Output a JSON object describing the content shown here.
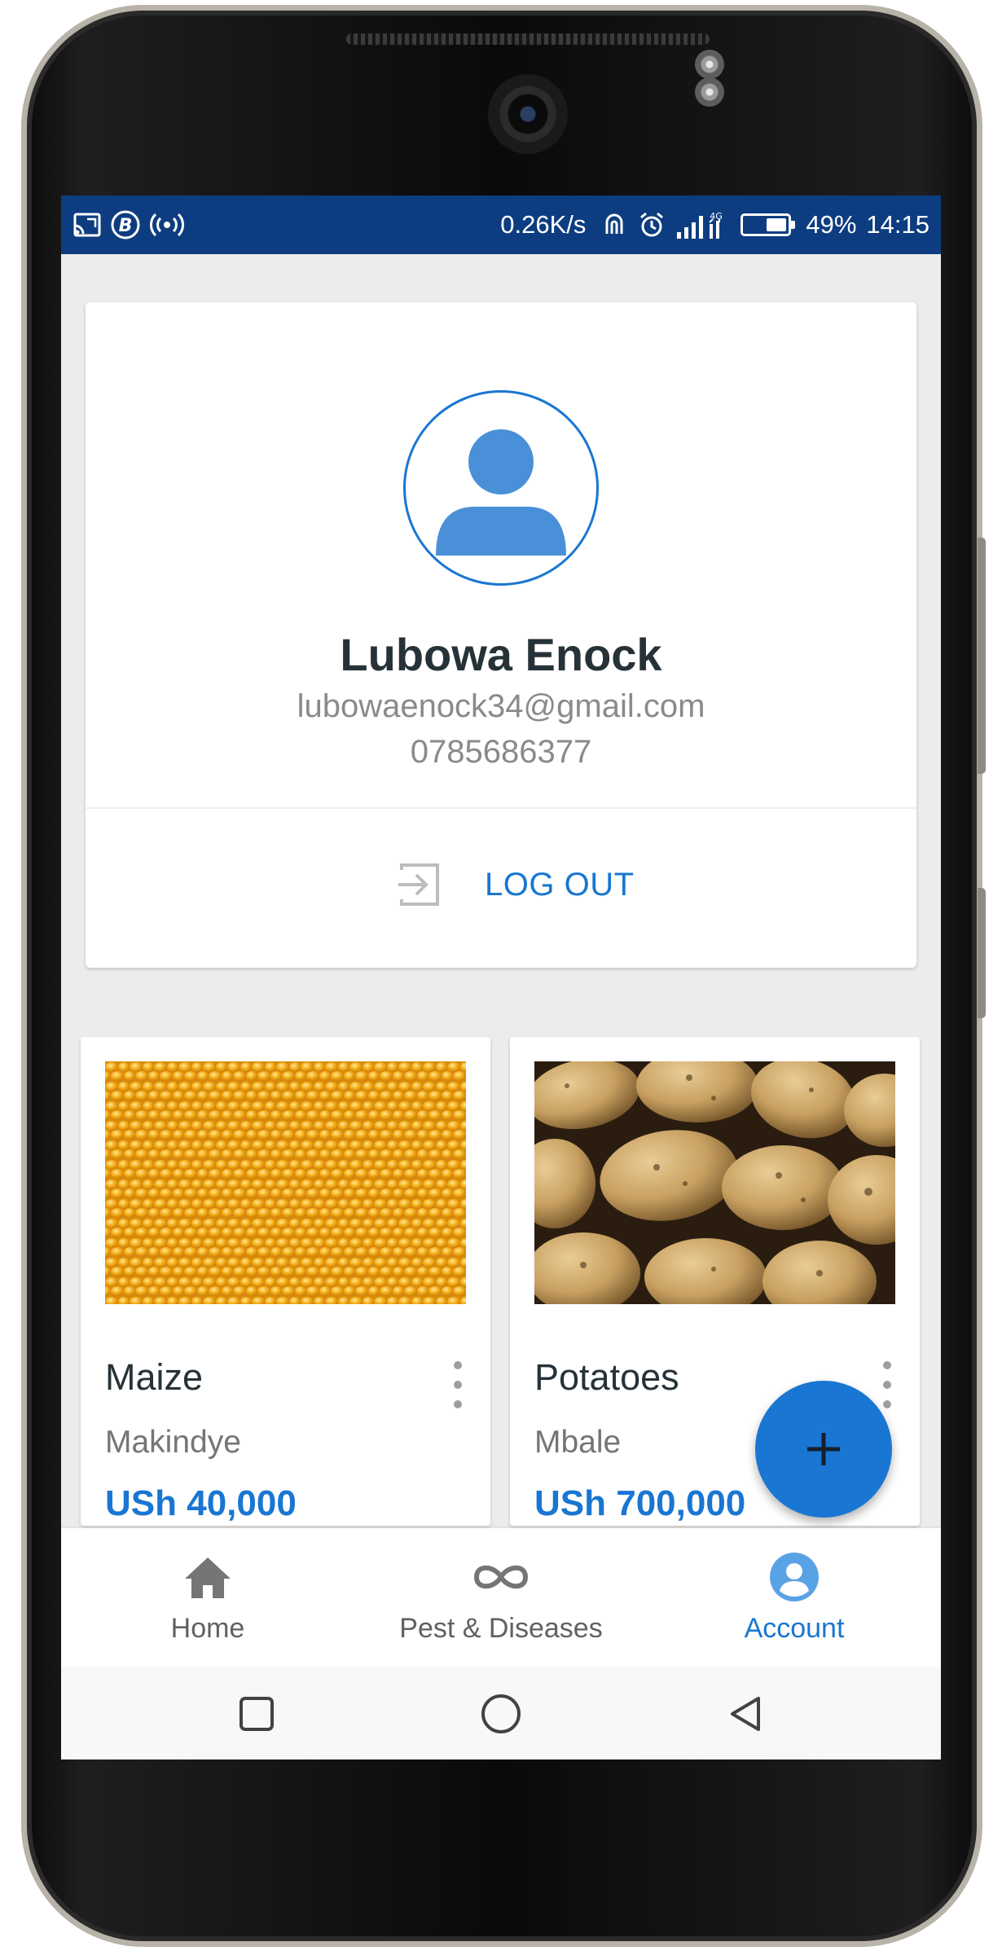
{
  "status_bar": {
    "network_speed": "0.26K/s",
    "signal_type": "4G",
    "battery_percent": "49%",
    "battery_level": 0.49,
    "time": "14:15",
    "icons": [
      "screencast-icon",
      "b-app-icon",
      "hotspot-icon",
      "nfc-icon",
      "alarm-icon",
      "signal-icon",
      "battery-icon"
    ]
  },
  "profile": {
    "name": "Lubowa Enock",
    "email": "lubowaenock34@gmail.com",
    "phone": "0785686377",
    "logout_label": "LOG OUT"
  },
  "products": [
    {
      "name": "Maize",
      "location": "Makindye",
      "price": "USh 40,000"
    },
    {
      "name": "Potatoes",
      "location": "Mbale",
      "price": "USh 700,000"
    }
  ],
  "fab": {
    "icon": "plus-icon"
  },
  "bottom_nav": {
    "items": [
      {
        "label": "Home",
        "icon": "home-icon",
        "active": false
      },
      {
        "label": "Pest & Diseases",
        "icon": "infinity-icon",
        "active": false
      },
      {
        "label": "Account",
        "icon": "account-circle-icon",
        "active": true
      }
    ]
  },
  "colors": {
    "accent": "#1976d2",
    "status_bar": "#0d3d80",
    "background": "#ececec"
  }
}
